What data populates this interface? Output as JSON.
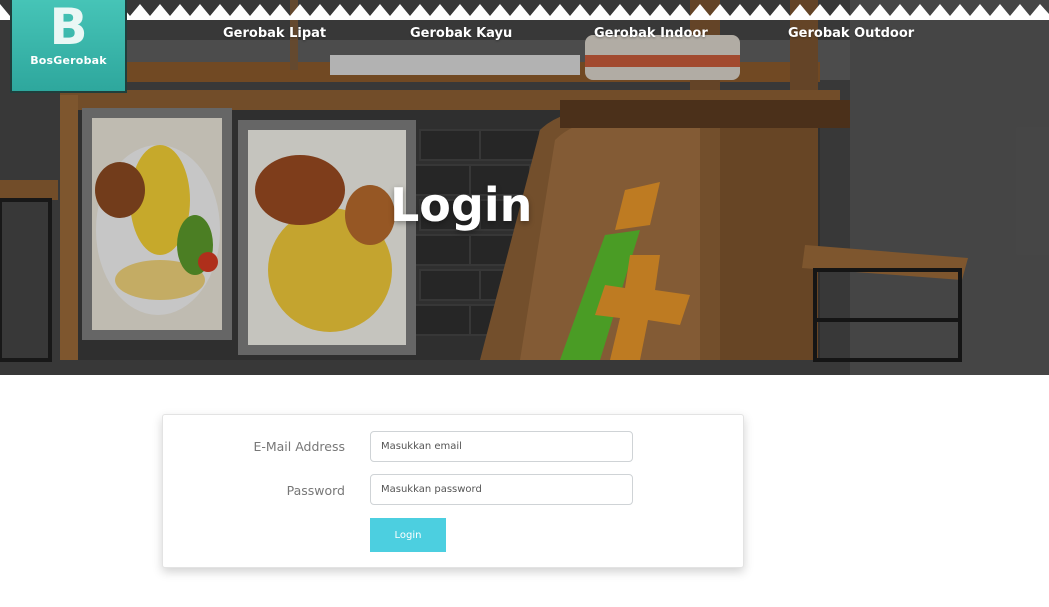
{
  "brand": {
    "logo_letter": "B",
    "name": "BosGerobak"
  },
  "nav": {
    "items": [
      {
        "label": "Gerobak Lipat"
      },
      {
        "label": "Gerobak Kayu"
      },
      {
        "label": "Gerobak Indoor"
      },
      {
        "label": "Gerobak Outdoor"
      }
    ]
  },
  "hero": {
    "title": "Login"
  },
  "form": {
    "email_label": "E-Mail Address",
    "email_placeholder": "Masukkan email",
    "email_value": "",
    "password_label": "Password",
    "password_placeholder": "Masukkan password",
    "password_value": "",
    "submit_label": "Login"
  },
  "colors": {
    "accent": "#4ccfe0",
    "logo": "#3bb8ac",
    "label_text": "#777777"
  }
}
